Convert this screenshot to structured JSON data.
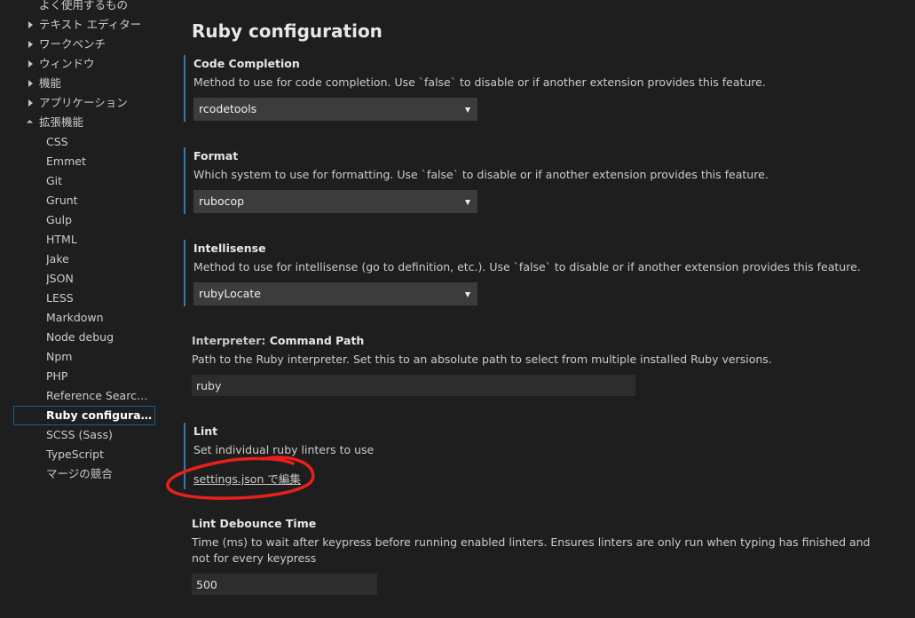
{
  "sidebar": {
    "items": [
      {
        "label": "よく使用するもの"
      },
      {
        "label": "テキスト エディター"
      },
      {
        "label": "ワークベンチ"
      },
      {
        "label": "ウィンドウ"
      },
      {
        "label": "機能"
      },
      {
        "label": "アプリケーション"
      },
      {
        "label": "拡張機能"
      }
    ],
    "extensions": [
      {
        "label": "CSS"
      },
      {
        "label": "Emmet"
      },
      {
        "label": "Git"
      },
      {
        "label": "Grunt"
      },
      {
        "label": "Gulp"
      },
      {
        "label": "HTML"
      },
      {
        "label": "Jake"
      },
      {
        "label": "JSON"
      },
      {
        "label": "LESS"
      },
      {
        "label": "Markdown"
      },
      {
        "label": "Node debug"
      },
      {
        "label": "Npm"
      },
      {
        "label": "PHP"
      },
      {
        "label": "Reference Search View"
      },
      {
        "label": "Ruby configuration"
      },
      {
        "label": "SCSS (Sass)"
      },
      {
        "label": "TypeScript"
      },
      {
        "label": "マージの競合"
      }
    ]
  },
  "main": {
    "title": "Ruby configuration",
    "settings": {
      "code_completion": {
        "title": "Code Completion",
        "description": "Method to use for code completion. Use `false` to disable or if another extension provides this feature.",
        "value": "rcodetools"
      },
      "format": {
        "title": "Format",
        "description": "Which system to use for formatting. Use `false` to disable or if another extension provides this feature.",
        "value": "rubocop"
      },
      "intellisense": {
        "title": "Intellisense",
        "description": "Method to use for intellisense (go to definition, etc.). Use `false` to disable or if another extension provides this feature.",
        "value": "rubyLocate"
      },
      "interpreter": {
        "category": "Interpreter: ",
        "title": "Command Path",
        "description": "Path to the Ruby interpreter. Set this to an absolute path to select from multiple installed Ruby versions.",
        "value": "ruby"
      },
      "lint": {
        "title": "Lint",
        "description": "Set individual ruby linters to use",
        "link": "settings.json で編集"
      },
      "lint_debounce": {
        "title": "Lint Debounce Time",
        "description": "Time (ms) to wait after keypress before running enabled linters. Ensures linters are only run when typing has finished and not for every keypress",
        "value": "500"
      }
    }
  },
  "colors": {
    "background": "#1e1e1e",
    "accent_bar": "#2d7bb8",
    "selection_border": "#0e639c",
    "annotation": "#e8201c"
  }
}
